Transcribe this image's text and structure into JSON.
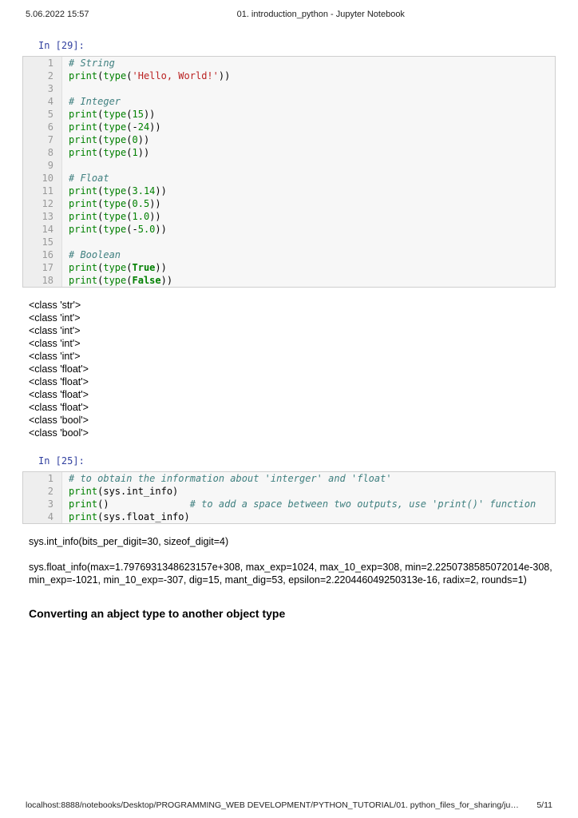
{
  "header": {
    "timestamp": "5.06.2022 15:57",
    "doc_title": "01. introduction_python - Jupyter Notebook"
  },
  "cell1": {
    "prompt": "In [29]:",
    "lines": [
      {
        "n": "1",
        "tokens": [
          {
            "t": "# String",
            "c": "c-comment"
          }
        ]
      },
      {
        "n": "2",
        "tokens": [
          {
            "t": "print",
            "c": "c-builtin"
          },
          {
            "t": "("
          },
          {
            "t": "type",
            "c": "c-name"
          },
          {
            "t": "("
          },
          {
            "t": "'Hello, World!'",
            "c": "c-str"
          },
          {
            "t": "))"
          }
        ]
      },
      {
        "n": "3",
        "tokens": []
      },
      {
        "n": "4",
        "tokens": [
          {
            "t": "# Integer",
            "c": "c-comment"
          }
        ]
      },
      {
        "n": "5",
        "tokens": [
          {
            "t": "print",
            "c": "c-builtin"
          },
          {
            "t": "("
          },
          {
            "t": "type",
            "c": "c-name"
          },
          {
            "t": "("
          },
          {
            "t": "15",
            "c": "c-num"
          },
          {
            "t": "))"
          }
        ]
      },
      {
        "n": "6",
        "tokens": [
          {
            "t": "print",
            "c": "c-builtin"
          },
          {
            "t": "("
          },
          {
            "t": "type",
            "c": "c-name"
          },
          {
            "t": "(-"
          },
          {
            "t": "24",
            "c": "c-num"
          },
          {
            "t": "))"
          }
        ]
      },
      {
        "n": "7",
        "tokens": [
          {
            "t": "print",
            "c": "c-builtin"
          },
          {
            "t": "("
          },
          {
            "t": "type",
            "c": "c-name"
          },
          {
            "t": "("
          },
          {
            "t": "0",
            "c": "c-num"
          },
          {
            "t": "))"
          }
        ]
      },
      {
        "n": "8",
        "tokens": [
          {
            "t": "print",
            "c": "c-builtin"
          },
          {
            "t": "("
          },
          {
            "t": "type",
            "c": "c-name"
          },
          {
            "t": "("
          },
          {
            "t": "1",
            "c": "c-num"
          },
          {
            "t": "))"
          }
        ]
      },
      {
        "n": "9",
        "tokens": []
      },
      {
        "n": "10",
        "tokens": [
          {
            "t": "# Float",
            "c": "c-comment"
          }
        ]
      },
      {
        "n": "11",
        "tokens": [
          {
            "t": "print",
            "c": "c-builtin"
          },
          {
            "t": "("
          },
          {
            "t": "type",
            "c": "c-name"
          },
          {
            "t": "("
          },
          {
            "t": "3.14",
            "c": "c-num"
          },
          {
            "t": "))"
          }
        ]
      },
      {
        "n": "12",
        "tokens": [
          {
            "t": "print",
            "c": "c-builtin"
          },
          {
            "t": "("
          },
          {
            "t": "type",
            "c": "c-name"
          },
          {
            "t": "("
          },
          {
            "t": "0.5",
            "c": "c-num"
          },
          {
            "t": "))"
          }
        ]
      },
      {
        "n": "13",
        "tokens": [
          {
            "t": "print",
            "c": "c-builtin"
          },
          {
            "t": "("
          },
          {
            "t": "type",
            "c": "c-name"
          },
          {
            "t": "("
          },
          {
            "t": "1.0",
            "c": "c-num"
          },
          {
            "t": "))"
          }
        ]
      },
      {
        "n": "14",
        "tokens": [
          {
            "t": "print",
            "c": "c-builtin"
          },
          {
            "t": "("
          },
          {
            "t": "type",
            "c": "c-name"
          },
          {
            "t": "(-"
          },
          {
            "t": "5.0",
            "c": "c-num"
          },
          {
            "t": "))"
          }
        ]
      },
      {
        "n": "15",
        "tokens": []
      },
      {
        "n": "16",
        "tokens": [
          {
            "t": "# Boolean",
            "c": "c-comment"
          }
        ]
      },
      {
        "n": "17",
        "tokens": [
          {
            "t": "print",
            "c": "c-builtin"
          },
          {
            "t": "("
          },
          {
            "t": "type",
            "c": "c-name"
          },
          {
            "t": "("
          },
          {
            "t": "True",
            "c": "c-bool"
          },
          {
            "t": "))"
          }
        ]
      },
      {
        "n": "18",
        "tokens": [
          {
            "t": "print",
            "c": "c-builtin"
          },
          {
            "t": "("
          },
          {
            "t": "type",
            "c": "c-name"
          },
          {
            "t": "("
          },
          {
            "t": "False",
            "c": "c-bool"
          },
          {
            "t": "))"
          }
        ]
      }
    ],
    "output": "<class 'str'>\n<class 'int'>\n<class 'int'>\n<class 'int'>\n<class 'int'>\n<class 'float'>\n<class 'float'>\n<class 'float'>\n<class 'float'>\n<class 'bool'>\n<class 'bool'>"
  },
  "cell2": {
    "prompt": "In [25]:",
    "lines": [
      {
        "n": "1",
        "tokens": [
          {
            "t": "# to obtain the information about 'interger' and 'float'",
            "c": "c-comment"
          }
        ]
      },
      {
        "n": "2",
        "tokens": [
          {
            "t": "print",
            "c": "c-builtin"
          },
          {
            "t": "(sys.int_info)"
          }
        ]
      },
      {
        "n": "3",
        "tokens": [
          {
            "t": "print",
            "c": "c-builtin"
          },
          {
            "t": "()              "
          },
          {
            "t": "# to add a space between two outputs, use 'print()' function",
            "c": "c-comment"
          }
        ]
      },
      {
        "n": "4",
        "tokens": [
          {
            "t": "print",
            "c": "c-builtin"
          },
          {
            "t": "(sys.float_info)"
          }
        ]
      }
    ],
    "output": "sys.int_info(bits_per_digit=30, sizeof_digit=4)\n\nsys.float_info(max=1.7976931348623157e+308, max_exp=1024, max_10_exp=308, min=2.2250738585072014e-308, min_exp=-1021, min_10_exp=-307, dig=15, mant_dig=53, epsilon=2.220446049250313e-16, radix=2, rounds=1)"
  },
  "section_heading": "Converting an abject type to another object type",
  "footer": {
    "path": "localhost:8888/notebooks/Desktop/PROGRAMMING_WEB DEVELOPMENT/PYTHON_TUTORIAL/01. python_files_for_sharing/jupyter_notebo…",
    "page": "5/11"
  }
}
